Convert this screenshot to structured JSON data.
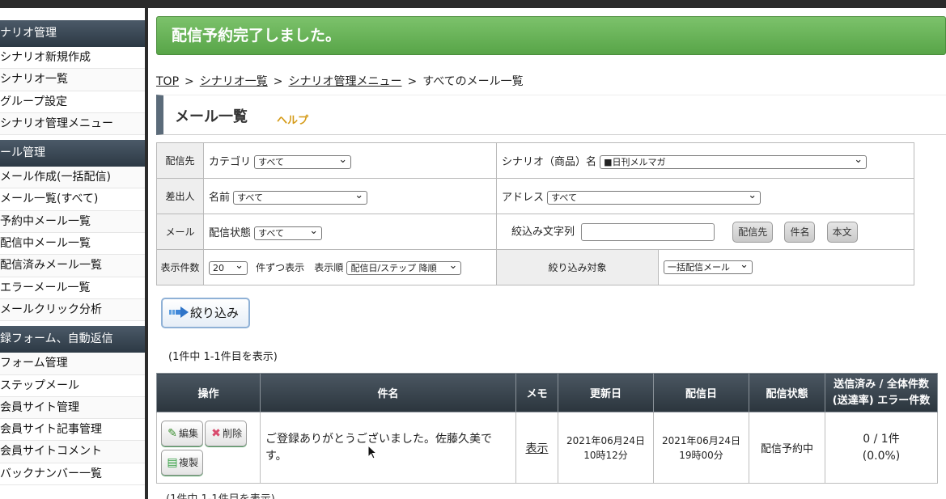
{
  "sidebar": {
    "sections": [
      {
        "title": "ナリオ管理",
        "items": [
          "シナリオ新規作成",
          "シナリオ一覧",
          "グループ設定",
          "シナリオ管理メニュー"
        ]
      },
      {
        "title": "ール管理",
        "items": [
          "メール作成(一括配信)",
          "メール一覧(すべて)",
          "予約中メール一覧",
          "配信中メール一覧",
          "配信済みメール一覧",
          "エラーメール一覧",
          "メールクリック分析"
        ]
      },
      {
        "title": "録フォーム、自動返信",
        "items": [
          "フォーム管理",
          "ステップメール",
          "会員サイト管理",
          "会員サイト記事管理",
          "会員サイトコメント",
          "バックナンバー一覧"
        ]
      }
    ]
  },
  "banner": "配信予約完了しました。",
  "breadcrumb": {
    "top": "TOP",
    "scenario_list": "シナリオ一覧",
    "scenario_menu": "シナリオ管理メニュー",
    "current": "すべてのメール一覧",
    "sep": ">"
  },
  "page": {
    "title": "メール一覧",
    "help": "ヘルプ"
  },
  "filter": {
    "row1": {
      "label": "配信先",
      "category_label": "カテゴリ",
      "category_value": "すべて",
      "scenario_label": "シナリオ（商品）名",
      "scenario_value": "■日刊メルマガ"
    },
    "row2": {
      "label": "差出人",
      "name_label": "名前",
      "name_value": "すべて",
      "address_label": "アドレス",
      "address_value": "すべて"
    },
    "row3": {
      "label": "メール",
      "status_label": "配信状態",
      "status_value": "すべて",
      "keyword_label": "絞込み文字列",
      "btn_dest": "配信先",
      "btn_subject": "件名",
      "btn_body": "本文"
    },
    "row4": {
      "label": "表示件数",
      "count_value": "20",
      "count_suffix": "件ずつ表示",
      "order_label": "表示順",
      "order_value": "配信日/ステップ 降順",
      "target_label": "絞り込み対象",
      "target_value": "一括配信メール"
    }
  },
  "search_button": "絞り込み",
  "result_count": "(1件中 1-1件目を表示)",
  "table": {
    "headers": {
      "ops": "操作",
      "subject": "件名",
      "memo": "メモ",
      "updated": "更新日",
      "delivery": "配信日",
      "status": "配信状態",
      "sent_line1": "送信済み / 全体件数",
      "sent_line2": "(送達率) エラー件数"
    },
    "row": {
      "edit": "編集",
      "delete": "削除",
      "copy": "複製",
      "subject": "ご登録ありがとうございました。佐藤久美です。",
      "memo": "表示",
      "updated_date": "2021年06月24日",
      "updated_time": "10時12分",
      "delivery_date": "2021年06月24日",
      "delivery_time": "19時00分",
      "status": "配信予約中",
      "sent": "0 / 1件",
      "rate": "(0.0%)"
    }
  }
}
